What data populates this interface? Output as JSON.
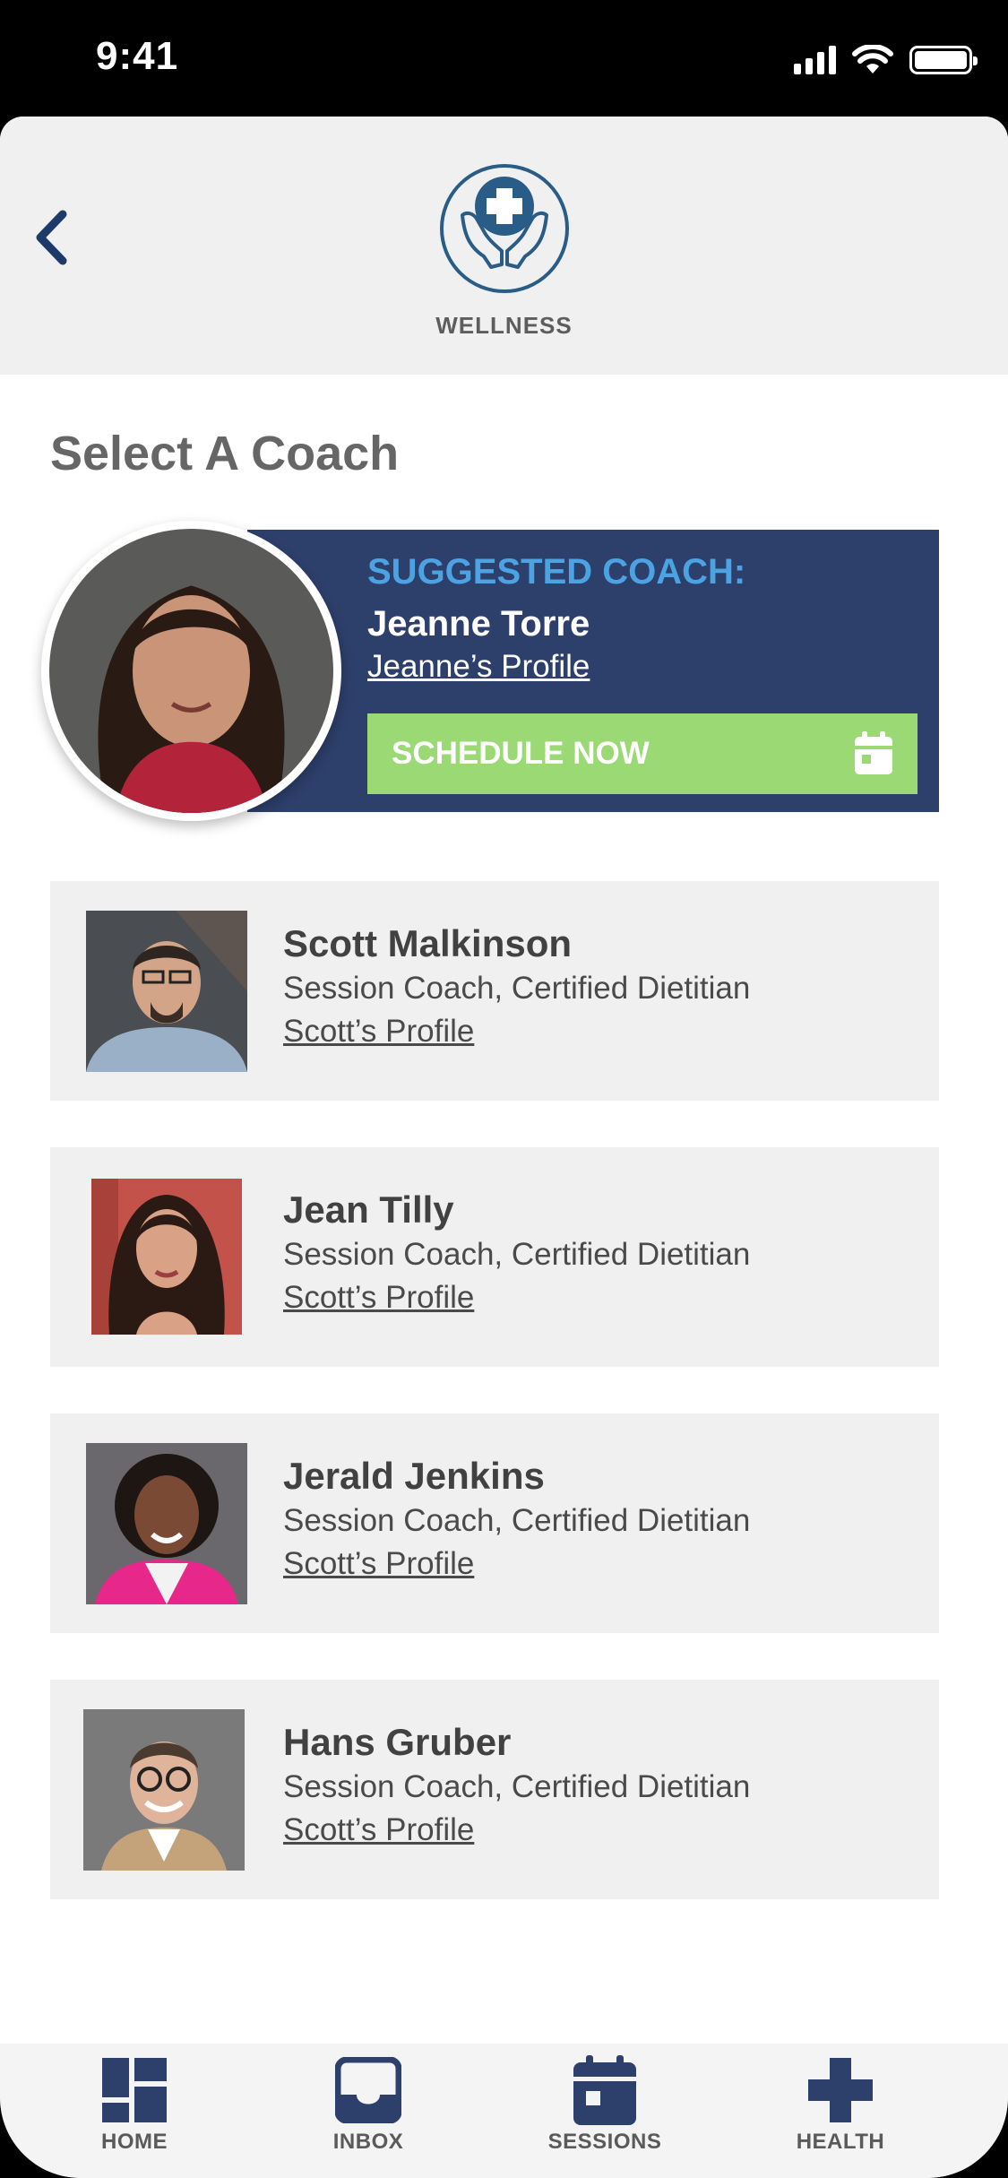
{
  "status_bar": {
    "time": "9:41"
  },
  "header": {
    "brand": "WELLNESS"
  },
  "page_title": "Select A Coach",
  "suggested": {
    "label": "SUGGESTED COACH:",
    "name": "Jeanne Torre",
    "profile_link": "Jeanne’s Profile",
    "schedule_label": "SCHEDULE NOW"
  },
  "coaches": [
    {
      "name": "Scott Malkinson",
      "role": "Session Coach, Certified Dietitian",
      "profile_link": "Scott’s Profile"
    },
    {
      "name": "Jean Tilly",
      "role": "Session Coach, Certified Dietitian",
      "profile_link": "Scott’s Profile"
    },
    {
      "name": "Jerald Jenkins",
      "role": "Session Coach, Certified Dietitian",
      "profile_link": "Scott’s Profile"
    },
    {
      "name": "Hans Gruber",
      "role": "Session Coach, Certified Dietitian",
      "profile_link": "Scott’s Profile"
    }
  ],
  "tabs": [
    {
      "label": "HOME",
      "icon": "dashboard-icon"
    },
    {
      "label": "INBOX",
      "icon": "inbox-icon"
    },
    {
      "label": "SESSIONS",
      "icon": "calendar-icon"
    },
    {
      "label": "HEALTH",
      "icon": "health-cross-icon"
    }
  ],
  "colors": {
    "navy": "#2d3f6b",
    "accent_blue": "#4ba3e4",
    "green": "#9ad973",
    "card_gray": "#f0f0f0"
  }
}
